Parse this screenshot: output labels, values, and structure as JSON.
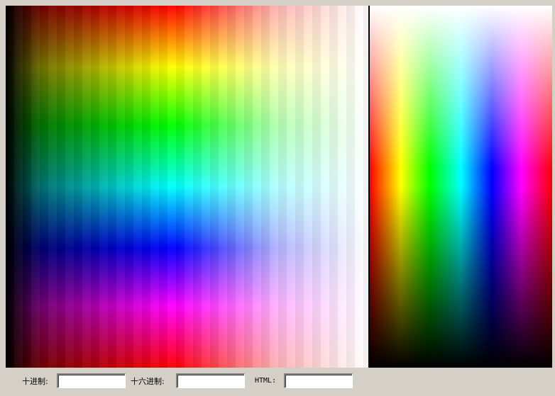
{
  "fields": {
    "decimal": {
      "label": "十进制:",
      "value": ""
    },
    "hex": {
      "label": "十六进制:",
      "value": ""
    },
    "html": {
      "label": "HTML:",
      "value": ""
    }
  }
}
